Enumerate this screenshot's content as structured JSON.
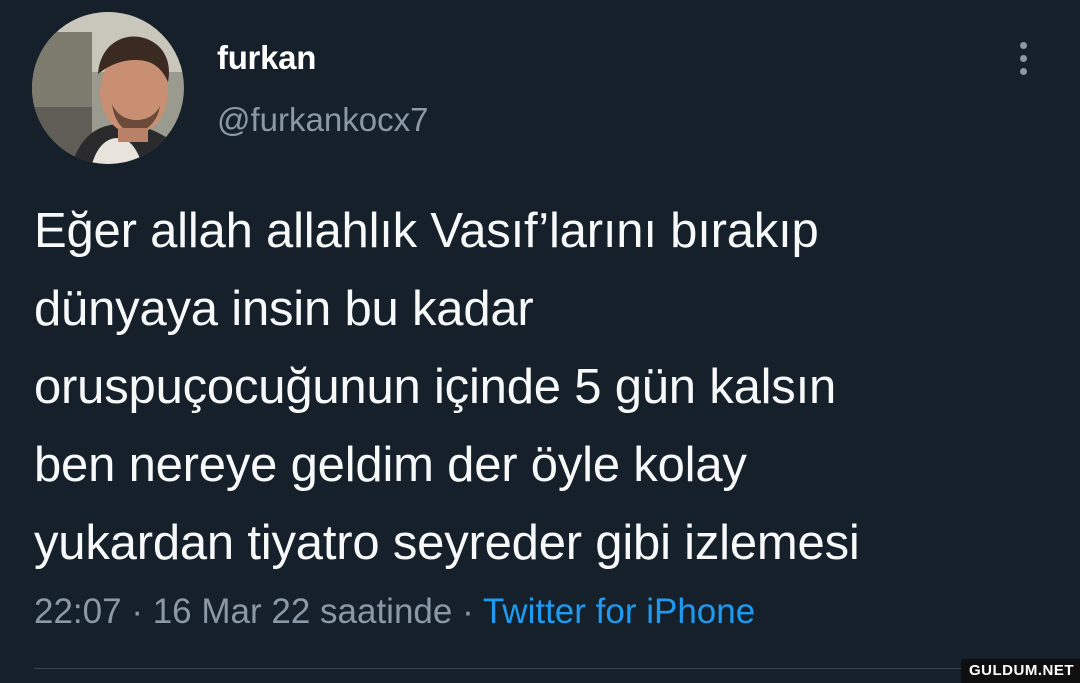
{
  "tweet": {
    "display_name": "furkan",
    "handle": "@furkankocx7",
    "lines": [
      "Eğer allah allahlık Vasıf’larını bırakıp",
      "dünyaya insin bu kadar",
      "oruspuçocuğunun içinde 5 gün kalsın",
      "ben nereye geldim der öyle kolay",
      "yukardan tiyatro seyreder gibi izlemesi"
    ],
    "time": "22:07",
    "separator": "·",
    "date": "16 Mar 22 saatinde",
    "source": "Twitter for iPhone"
  },
  "icons": {
    "more": "more-vertical-icon"
  },
  "watermark": "GULDUM.NET",
  "colors": {
    "background": "#15202b",
    "primary_text": "#f7f9f9",
    "secondary_text": "#8b98a5",
    "accent": "#1d9bf0"
  }
}
